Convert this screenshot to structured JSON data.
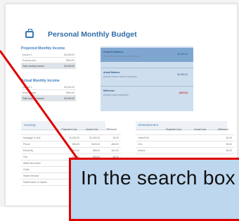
{
  "doc": {
    "title": "Personal Monthly Budget",
    "projected_income": {
      "heading": "Projected Monthly Income",
      "rows": [
        {
          "label": "Income 1",
          "value": "$4,000.00"
        },
        {
          "label": "Extra income",
          "value": "$300.00"
        },
        {
          "label": "Total monthly income",
          "value": "$4,300.00"
        }
      ]
    },
    "actual_income": {
      "heading": "Actual Monthly Income",
      "rows": [
        {
          "label": "Income 1",
          "value": "$4,000.00"
        },
        {
          "label": "Extra income",
          "value": "$300.00"
        },
        {
          "label": "Total monthly income",
          "value": "$4,300.00"
        }
      ]
    },
    "summary": {
      "rows": [
        {
          "label": "Projected Balance",
          "sub": "(Projected income minus expenses)",
          "value": "$3,405.00"
        },
        {
          "label": "Actual Balance",
          "sub": "(Actual income minus expenses)",
          "value": "$3,360.00"
        },
        {
          "label": "Difference",
          "sub": "(Actual minus projected)",
          "value": "($45.00)"
        }
      ]
    },
    "housing": {
      "heading": "Housing",
      "columns": [
        "",
        "Projected Cost",
        "Actual Cost",
        "Difference"
      ],
      "rows": [
        [
          "Mortgage or rent",
          "$1,000.00",
          "$1,000.00",
          "$0.00"
        ],
        [
          "Phone",
          "$54.00",
          "$100.00",
          "-$46.00"
        ],
        [
          "Electricity",
          "$44.00",
          "$56.00",
          "-$12.00"
        ],
        [
          "Gas",
          "$22.00",
          "$28.00",
          "-$6.00"
        ],
        [
          "Water and sewer",
          "$8.00",
          "$8.00",
          "$0.00"
        ],
        [
          "Cable",
          "$34.00",
          "$34.00",
          "$0.00"
        ],
        [
          "Waste removal",
          "$10.00",
          "$10.00",
          "$0.00"
        ],
        [
          "Maintenance or repairs",
          "$23.00",
          "$0.00",
          "$23.00"
        ]
      ]
    },
    "entertainment": {
      "heading": "Entertainment",
      "columns": [
        "",
        "Projected Cost",
        "Actual Cost",
        "Difference"
      ],
      "rows": [
        [
          "Video/DVD",
          "",
          "",
          "$0.00"
        ],
        [
          "CDs",
          "",
          "",
          "$0.00"
        ],
        [
          "Movies",
          "",
          "",
          "$0.00"
        ]
      ]
    }
  },
  "callout": {
    "text": "In the search box"
  },
  "colors": {
    "accent": "#2f6ca7",
    "callout_fill": "#bdd7ee",
    "callout_border": "#e00000",
    "pointer_line": "#e00000"
  }
}
